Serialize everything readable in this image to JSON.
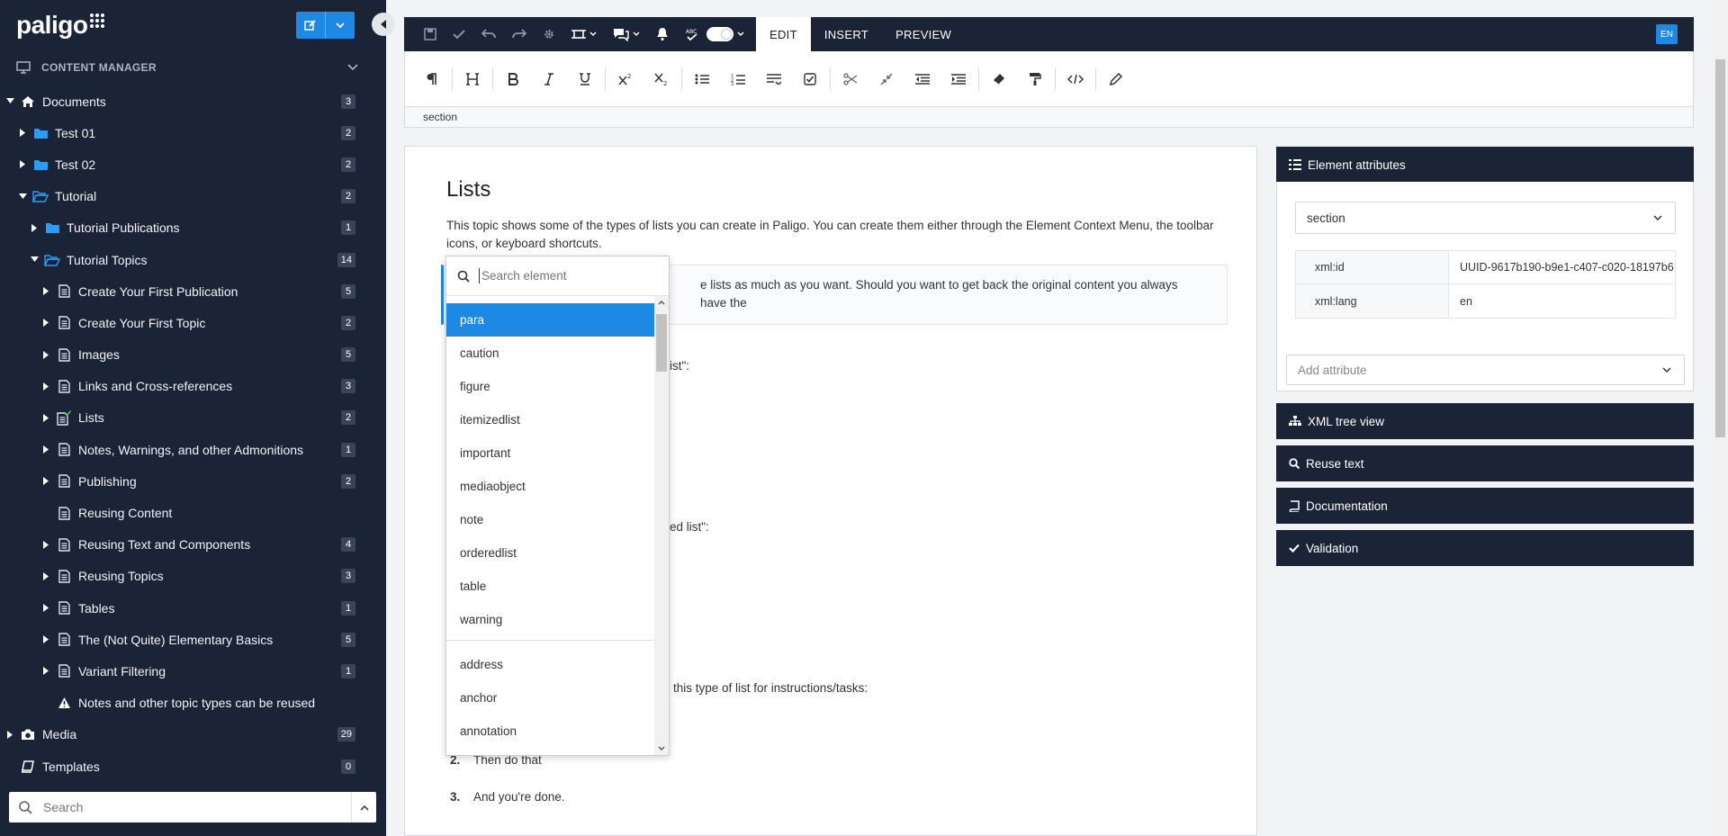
{
  "app": {
    "logo": "paligo"
  },
  "sidebar": {
    "section_label": "CONTENT MANAGER",
    "tree": [
      {
        "label": "Documents",
        "count": "3",
        "level": 0,
        "icon": "home",
        "caret": "down"
      },
      {
        "label": "Test 01",
        "count": "2",
        "level": 1,
        "icon": "folder",
        "caret": "right"
      },
      {
        "label": "Test 02",
        "count": "2",
        "level": 1,
        "icon": "folder",
        "caret": "right"
      },
      {
        "label": "Tutorial",
        "count": "2",
        "level": 1,
        "icon": "folder-open",
        "caret": "down"
      },
      {
        "label": "Tutorial Publications",
        "count": "1",
        "level": 2,
        "icon": "folder",
        "caret": "right"
      },
      {
        "label": "Tutorial Topics",
        "count": "14",
        "level": 2,
        "icon": "folder-open",
        "caret": "down"
      },
      {
        "label": "Create Your First Publication",
        "count": "5",
        "level": 3,
        "icon": "doc",
        "caret": "right"
      },
      {
        "label": "Create Your First Topic",
        "count": "2",
        "level": 3,
        "icon": "doc",
        "caret": "right"
      },
      {
        "label": "Images",
        "count": "5",
        "level": 3,
        "icon": "doc",
        "caret": "right"
      },
      {
        "label": "Links and Cross-references",
        "count": "3",
        "level": 3,
        "icon": "doc",
        "caret": "right"
      },
      {
        "label": "Lists",
        "count": "2",
        "level": 3,
        "icon": "doc-check",
        "caret": "right"
      },
      {
        "label": "Notes, Warnings, and other Admonitions",
        "count": "1",
        "level": 3,
        "icon": "doc",
        "caret": "right"
      },
      {
        "label": "Publishing",
        "count": "2",
        "level": 3,
        "icon": "doc",
        "caret": "right"
      },
      {
        "label": "Reusing Content",
        "count": "",
        "level": 3,
        "icon": "doc",
        "caret": "none"
      },
      {
        "label": "Reusing Text and Components",
        "count": "4",
        "level": 3,
        "icon": "doc",
        "caret": "right"
      },
      {
        "label": "Reusing Topics",
        "count": "3",
        "level": 3,
        "icon": "doc",
        "caret": "right"
      },
      {
        "label": "Tables",
        "count": "1",
        "level": 3,
        "icon": "doc",
        "caret": "right"
      },
      {
        "label": "The (Not Quite) Elementary Basics",
        "count": "5",
        "level": 3,
        "icon": "doc",
        "caret": "right"
      },
      {
        "label": "Variant Filtering",
        "count": "1",
        "level": 3,
        "icon": "doc",
        "caret": "right"
      },
      {
        "label": "Notes and other topic types can be reused",
        "count": "",
        "level": 3,
        "icon": "warning",
        "caret": "none"
      },
      {
        "label": "Media",
        "count": "29",
        "level": 0,
        "icon": "camera",
        "caret": "right"
      },
      {
        "label": "Templates",
        "count": "0",
        "level": 0,
        "icon": "book",
        "caret": "none"
      }
    ],
    "search_placeholder": "Search"
  },
  "editor": {
    "tabs": [
      "EDIT",
      "INSERT",
      "PREVIEW"
    ],
    "active_tab": "EDIT",
    "language": "EN",
    "breadcrumb": "section"
  },
  "document": {
    "title": "Lists",
    "intro": "This topic shows some of the types of lists you can create in Paligo. You can create them either through the Element Context Menu, the toolbar icons, or keyboard shortcuts.",
    "note_text": "e lists as much as you want. Should you want to get back the original content you always have the",
    "fragments": [
      "ist\":",
      "ed list\":",
      "this type of list for instructions/tasks:"
    ],
    "steps": [
      {
        "num": "2.",
        "text": "Then do that"
      },
      {
        "num": "3.",
        "text": "And you're done."
      }
    ]
  },
  "element_dropdown": {
    "placeholder": "Search element",
    "common": [
      "para",
      "caution",
      "figure",
      "itemizedlist",
      "important",
      "mediaobject",
      "note",
      "orderedlist",
      "table",
      "warning"
    ],
    "all": [
      "address",
      "anchor",
      "annotation"
    ],
    "selected": "para"
  },
  "right_panel": {
    "element_attributes": {
      "title": "Element attributes",
      "element": "section",
      "attributes": [
        {
          "key": "xml:id",
          "value": "UUID-9617b190-b9e1-c407-c020-18197b6"
        },
        {
          "key": "xml:lang",
          "value": "en"
        }
      ],
      "add_placeholder": "Add attribute"
    },
    "panels": [
      "XML tree view",
      "Reuse text",
      "Documentation",
      "Validation"
    ]
  },
  "colors": {
    "sidebar_bg": "#1b2336",
    "accent": "#1e88e5",
    "badge_bg": "#3a4459"
  }
}
